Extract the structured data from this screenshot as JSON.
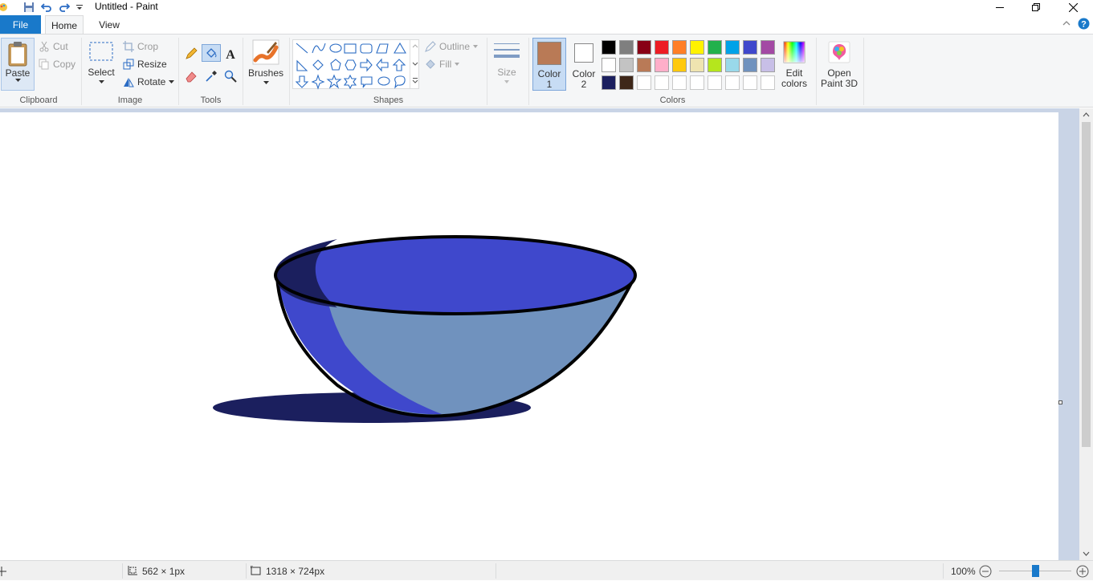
{
  "window": {
    "title": "Untitled - Paint"
  },
  "tabs": {
    "file": "File",
    "home": "Home",
    "view": "View"
  },
  "clipboard": {
    "paste": "Paste",
    "cut": "Cut",
    "copy": "Copy",
    "label": "Clipboard"
  },
  "image": {
    "select": "Select",
    "crop": "Crop",
    "resize": "Resize",
    "rotate": "Rotate",
    "label": "Image"
  },
  "tools": {
    "label": "Tools"
  },
  "brushes": {
    "label": "Brushes"
  },
  "shapes": {
    "outline": "Outline",
    "fill": "Fill",
    "label": "Shapes"
  },
  "size": {
    "label": "Size"
  },
  "colors": {
    "color1_line1": "Color",
    "color1_line2": "1",
    "color2_line1": "Color",
    "color2_line2": "2",
    "color1_value": "#b97a56",
    "color2_value": "#ffffff",
    "edit_line1": "Edit",
    "edit_line2": "colors",
    "label": "Colors",
    "palette_row1": [
      "#000000",
      "#7f7f7f",
      "#880015",
      "#ed1c24",
      "#ff7f27",
      "#fff200",
      "#22b14c",
      "#00a2e8",
      "#3f48cc",
      "#a349a4"
    ],
    "palette_row2": [
      "#ffffff",
      "#c3c3c3",
      "#b97a57",
      "#ffaec9",
      "#ffc90e",
      "#efe4b0",
      "#b5e61d",
      "#99d9ea",
      "#7092be",
      "#c8bfe7"
    ],
    "palette_row3": [
      "#1b1f5e",
      "#3e2719",
      "",
      "",
      "",
      "",
      "",
      "",
      "",
      ""
    ]
  },
  "paint3d": {
    "line1": "Open",
    "line2": "Paint 3D"
  },
  "status": {
    "selection_size": "562 × 1px",
    "canvas_size": "1318 × 724px",
    "zoom": "100%",
    "zoom_value": 100
  }
}
